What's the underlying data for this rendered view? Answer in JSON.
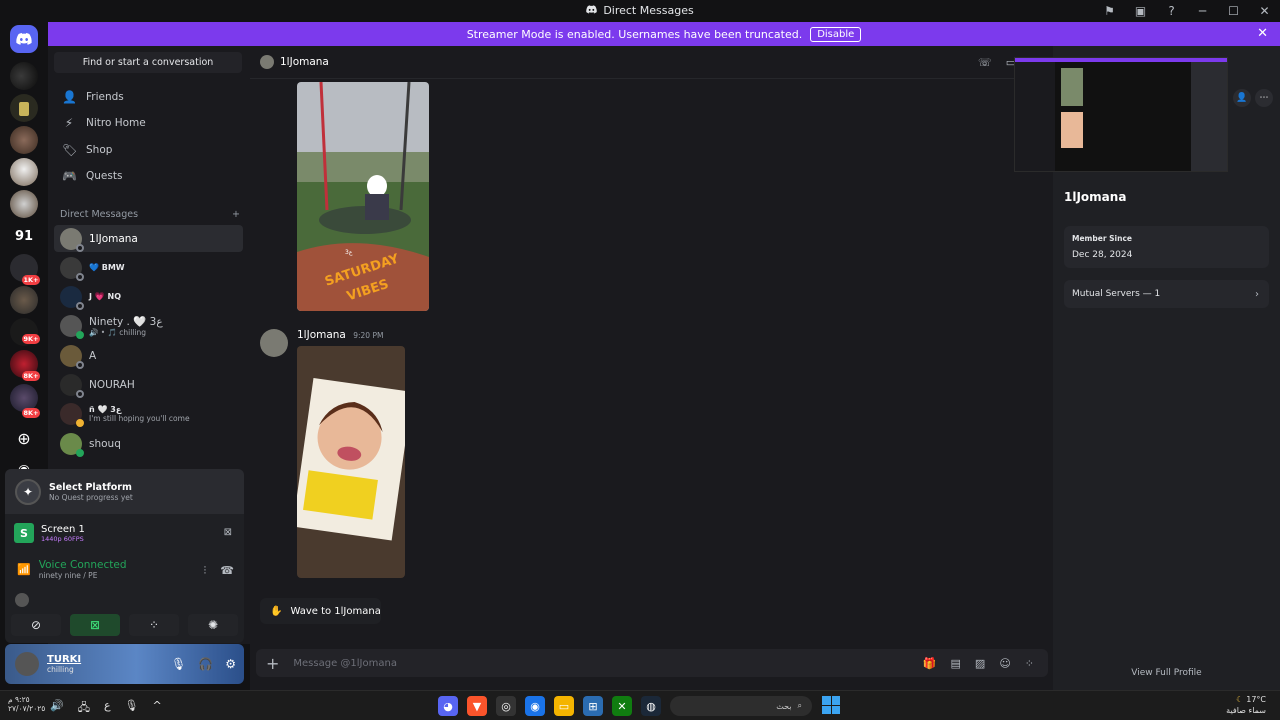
{
  "window": {
    "title": "Direct Messages"
  },
  "banner": {
    "text": "Streamer Mode is enabled. Usernames have been truncated.",
    "disable_label": "Disable"
  },
  "guild_badges": [
    "1K+",
    "9K+",
    "8K+",
    "8K+"
  ],
  "guild_label_91": "91",
  "search": {
    "label": "Find or start a conversation"
  },
  "nav": [
    {
      "label": "Friends",
      "icon": "friends-icon"
    },
    {
      "label": "Nitro Home",
      "icon": "nitro-icon"
    },
    {
      "label": "Shop",
      "icon": "shop-icon"
    },
    {
      "label": "Quests",
      "icon": "quests-icon"
    }
  ],
  "dm_header": "Direct Messages",
  "dms": [
    {
      "name": "1lJomana",
      "sub": ""
    },
    {
      "name": "💙 BMW",
      "sub": ""
    },
    {
      "name": "J 💗 NQ",
      "sub": ""
    },
    {
      "name": "Ninety . 🤍 ع3",
      "sub": "🔊 • 🎵 chilling"
    },
    {
      "name": "A",
      "sub": ""
    },
    {
      "name": "NOURAH",
      "sub": ""
    },
    {
      "name": "ñ 🤍 ع3",
      "sub": "I'm still hoping you'll come"
    },
    {
      "name": "shouq",
      "sub": ""
    }
  ],
  "quest": {
    "title": "Select Platform",
    "subtitle": "No Quest progress yet"
  },
  "stream": {
    "title": "Screen 1",
    "quality": "1440p 60FPS"
  },
  "voice": {
    "status": "Voice Connected",
    "channel": "ninety nine / PE"
  },
  "user": {
    "name": "TURKI",
    "status": "chilling"
  },
  "chat": {
    "recipient": "1lJomana",
    "message_author": "1lJomana",
    "message_time": "9:20 PM",
    "wave_label": "Wave to 1lJomana",
    "placeholder": "Message @1lJomana"
  },
  "image_texts": {
    "sticker1": "SATURDAY",
    "sticker2": "VIBES",
    "sticker_small": "ع3"
  },
  "profile": {
    "name": "1lJomana",
    "member_since_label": "Member Since",
    "member_since": "Dec 28, 2024",
    "mutual": "Mutual Servers — 1",
    "view_full": "View Full Profile"
  },
  "taskbar": {
    "time": "٩:٢٥ م",
    "date": "٢٧/٠٧/٢٠٢٥",
    "lang": "ع",
    "search_text": "بحث",
    "weather_temp": "17°C",
    "weather_desc": "سماء صافية"
  }
}
